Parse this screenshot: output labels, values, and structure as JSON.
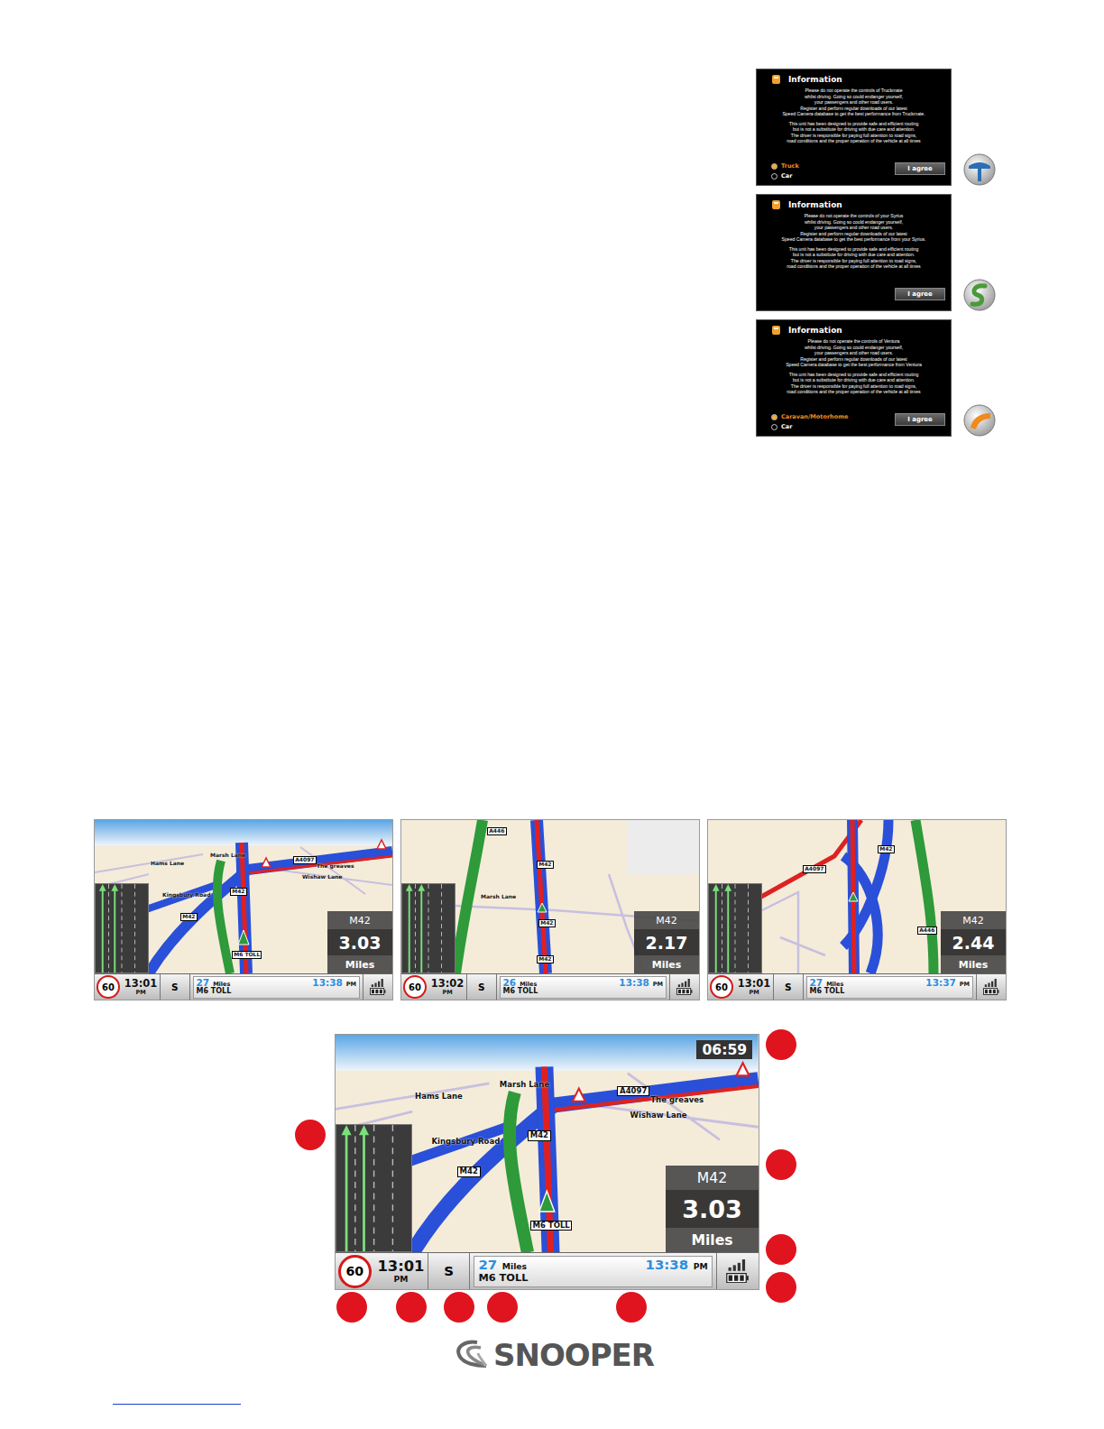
{
  "dialogs": [
    {
      "kind": "truckmate",
      "title": "Information",
      "paragraphs": [
        [
          "Please do not operate the controls of Truckmate",
          "whilst driving. Going so could endanger yourself,",
          "your passengers and other road users.",
          "Register and perform regular downloads of our latest",
          "Speed Camera database to get the best performance from Truckmate."
        ],
        [
          "This unit has been designed to provide safe and efficient routing",
          "but is not a substitute for driving with due care and attention.",
          "The driver is responsible for paying full attention to road signs,",
          "road conditions and the proper operation of the vehicle at all times"
        ]
      ],
      "options": [
        {
          "label": "Truck",
          "selected": true
        },
        {
          "label": "Car",
          "selected": false
        }
      ],
      "button": "I agree"
    },
    {
      "kind": "syrius",
      "title": "Information",
      "paragraphs": [
        [
          "Please do not operate the controls of your Syrius",
          "whilst driving. Going so could endanger yourself,",
          "your passengers and other road users.",
          "Register and perform regular downloads of our latest",
          "Speed Camera database to get the best performance from your Syrius."
        ],
        [
          "This unit has been designed to provide safe and efficient routing",
          "but is not a substitute for driving with due care and attention.",
          "The driver is responsible for paying full attention to road signs,",
          "road conditions and the proper operation of the vehicle at all times"
        ]
      ],
      "options": [],
      "button": "I agree"
    },
    {
      "kind": "ventura",
      "title": "Information",
      "paragraphs": [
        [
          "Please do not operate the controls of Ventura",
          "whilst driving. Going so could endanger yourself,",
          "your passengers and other road users.",
          "Register and perform regular downloads of our latest",
          "Speed Camera database to get the best performance from Ventura"
        ],
        [
          "This unit has been designed to provide safe and efficient routing",
          "but is not a substitute for driving with due care and attention.",
          "The driver is responsible for paying full attention to road signs,",
          "road conditions and the proper operation of the vehicle at all times"
        ]
      ],
      "options": [
        {
          "label": "Caravan/Motorhome",
          "selected": true
        },
        {
          "label": "Car",
          "selected": false
        }
      ],
      "button": "I agree"
    }
  ],
  "maps": [
    {
      "view": "3d",
      "speedLimit": "60",
      "time": "13:01",
      "timeSuffix": "PM",
      "heading": "S",
      "distance": "27",
      "distanceUnit": "Miles",
      "eta": "13:38",
      "etaSuffix": "PM",
      "road": "M6 TOLL",
      "nextRoad": "M42",
      "nextDistance": "3.03",
      "nextUnit": "Miles",
      "labels": [
        {
          "text": "Hams Lane",
          "kind": "street"
        },
        {
          "text": "Marsh Lane",
          "kind": "street"
        },
        {
          "text": "The greaves",
          "kind": "street"
        },
        {
          "text": "A4097",
          "kind": "shield"
        },
        {
          "text": "Wishaw Lane",
          "kind": "street"
        },
        {
          "text": "Kingsbury Road",
          "kind": "street"
        },
        {
          "text": "M42",
          "kind": "shield"
        },
        {
          "text": "M42",
          "kind": "shield"
        },
        {
          "text": "M6 TOLL",
          "kind": "shield"
        }
      ]
    },
    {
      "view": "north",
      "speedLimit": "60",
      "time": "13:02",
      "timeSuffix": "PM",
      "heading": "S",
      "distance": "26",
      "distanceUnit": "Miles",
      "eta": "13:38",
      "etaSuffix": "PM",
      "road": "M6 TOLL",
      "nextRoad": "M42",
      "nextDistance": "2.17",
      "nextUnit": "Miles",
      "labels": [
        {
          "text": "A446",
          "kind": "shield"
        },
        {
          "text": "Marsh Lane",
          "kind": "street"
        },
        {
          "text": "M42",
          "kind": "shield"
        },
        {
          "text": "M42",
          "kind": "shield"
        },
        {
          "text": "M42",
          "kind": "shield"
        }
      ]
    },
    {
      "view": "heading",
      "speedLimit": "60",
      "time": "13:01",
      "timeSuffix": "PM",
      "heading": "S",
      "distance": "27",
      "distanceUnit": "Miles",
      "eta": "13:37",
      "etaSuffix": "PM",
      "road": "M6 TOLL",
      "nextRoad": "M42",
      "nextDistance": "2.44",
      "nextUnit": "Miles",
      "labels": [
        {
          "text": "A4097",
          "kind": "shield"
        },
        {
          "text": "M42",
          "kind": "shield"
        },
        {
          "text": "A446",
          "kind": "shield"
        }
      ]
    }
  ],
  "detailMap": {
    "view": "3d",
    "clock": "06:59",
    "speedLimit": "60",
    "time": "13:01",
    "timeSuffix": "PM",
    "heading": "S",
    "distance": "27",
    "distanceUnit": "Miles",
    "eta": "13:38",
    "etaSuffix": "PM",
    "road": "M6 TOLL",
    "nextRoad": "M42",
    "nextDistance": "3.03",
    "nextUnit": "Miles",
    "labels": [
      {
        "text": "Hams Lane",
        "kind": "street"
      },
      {
        "text": "Marsh Lane",
        "kind": "street"
      },
      {
        "text": "The greaves",
        "kind": "street"
      },
      {
        "text": "A4097",
        "kind": "shield"
      },
      {
        "text": "Wishaw Lane",
        "kind": "street"
      },
      {
        "text": "Kingsbury Road",
        "kind": "street"
      },
      {
        "text": "M42",
        "kind": "shield"
      },
      {
        "text": "M42",
        "kind": "shield"
      },
      {
        "text": "M6 TOLL",
        "kind": "shield"
      }
    ]
  },
  "brand": "SNOOPER"
}
